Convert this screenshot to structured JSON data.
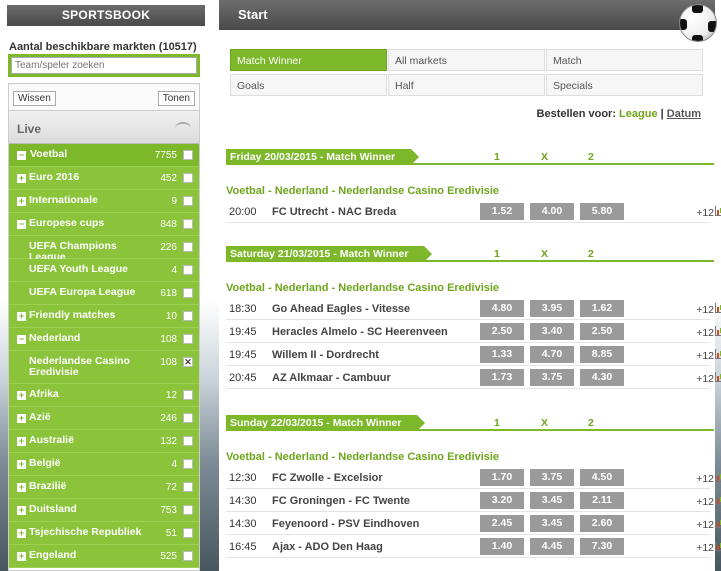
{
  "sidebar": {
    "title": "SPORTSBOOK",
    "markets_label": "Aantal beschikbare markten (10517)",
    "search_placeholder": "Team/speler zoeken",
    "clear_label": "Wissen",
    "show_label": "Tonen",
    "live_label": "Live",
    "categories": [
      {
        "name": "Voetbal",
        "count": "7755",
        "type": "main",
        "sign": "−"
      },
      {
        "name": "Euro 2016",
        "count": "452",
        "type": "sub",
        "sign": "+"
      },
      {
        "name": "Internationale",
        "count": "9",
        "type": "sub",
        "sign": "+"
      },
      {
        "name": "Europese cups",
        "count": "848",
        "type": "sub",
        "sign": "−"
      },
      {
        "name": "UEFA Champions League",
        "count": "226",
        "type": "subsub"
      },
      {
        "name": "UEFA Youth League",
        "count": "4",
        "type": "subsub"
      },
      {
        "name": "UEFA Europa League",
        "count": "618",
        "type": "subsub"
      },
      {
        "name": "Friendly matches",
        "count": "10",
        "type": "sub",
        "sign": "+"
      },
      {
        "name": "Nederland",
        "count": "108",
        "type": "sub",
        "sign": "−"
      },
      {
        "name": "Nederlandse Casino Eredivisie",
        "count": "108",
        "type": "subsub",
        "checked": true
      },
      {
        "name": "Afrika",
        "count": "12",
        "type": "sub",
        "sign": "+"
      },
      {
        "name": "Azië",
        "count": "246",
        "type": "sub",
        "sign": "+"
      },
      {
        "name": "Australië",
        "count": "132",
        "type": "sub",
        "sign": "+"
      },
      {
        "name": "België",
        "count": "4",
        "type": "sub",
        "sign": "+"
      },
      {
        "name": "Brazilië",
        "count": "72",
        "type": "sub",
        "sign": "+"
      },
      {
        "name": "Duitsland",
        "count": "753",
        "type": "sub",
        "sign": "+"
      },
      {
        "name": "Tsjechische Republiek",
        "count": "51",
        "type": "sub",
        "sign": "+"
      },
      {
        "name": "Engeland",
        "count": "525",
        "type": "sub",
        "sign": "+"
      }
    ]
  },
  "main": {
    "title": "Start",
    "tabs": [
      {
        "label": "Match Winner",
        "active": true
      },
      {
        "label": "All markets"
      },
      {
        "label": "Match"
      },
      {
        "label": "Goals"
      },
      {
        "label": "Half"
      },
      {
        "label": "Specials"
      }
    ],
    "sort_label": "Bestellen voor:",
    "sort_league": "League",
    "sort_sep": "|",
    "sort_date": "Datum",
    "col1": "1",
    "colx": "X",
    "col2": "2",
    "days": [
      {
        "heading": "Friday 20/03/2015 - Match Winner",
        "league": "Voetbal - Nederland - Nederlandse Casino Eredivisie",
        "matches": [
          {
            "time": "20:00",
            "teams": "FC Utrecht - NAC Breda",
            "o1": "1.52",
            "ox": "4.00",
            "o2": "5.80",
            "more": "+12"
          }
        ]
      },
      {
        "heading": "Saturday 21/03/2015 - Match Winner",
        "league": "Voetbal - Nederland - Nederlandse Casino Eredivisie",
        "matches": [
          {
            "time": "18:30",
            "teams": "Go Ahead Eagles - Vitesse",
            "o1": "4.80",
            "ox": "3.95",
            "o2": "1.62",
            "more": "+12"
          },
          {
            "time": "19:45",
            "teams": "Heracles Almelo - SC Heerenveen",
            "o1": "2.50",
            "ox": "3.40",
            "o2": "2.50",
            "more": "+12"
          },
          {
            "time": "19:45",
            "teams": "Willem II - Dordrecht",
            "o1": "1.33",
            "ox": "4.70",
            "o2": "8.85",
            "more": "+12"
          },
          {
            "time": "20:45",
            "teams": "AZ Alkmaar - Cambuur",
            "o1": "1.73",
            "ox": "3.75",
            "o2": "4.30",
            "more": "+12"
          }
        ]
      },
      {
        "heading": "Sunday 22/03/2015 - Match Winner",
        "league": "Voetbal - Nederland - Nederlandse Casino Eredivisie",
        "matches": [
          {
            "time": "12:30",
            "teams": "FC Zwolle - Excelsior",
            "o1": "1.70",
            "ox": "3.75",
            "o2": "4.50",
            "more": "+12"
          },
          {
            "time": "14:30",
            "teams": "FC Groningen - FC Twente",
            "o1": "3.20",
            "ox": "3.45",
            "o2": "2.11",
            "more": "+12"
          },
          {
            "time": "14:30",
            "teams": "Feyenoord - PSV Eindhoven",
            "o1": "2.45",
            "ox": "3.45",
            "o2": "2.60",
            "more": "+12"
          },
          {
            "time": "16:45",
            "teams": "Ajax - ADO Den Haag",
            "o1": "1.40",
            "ox": "4.45",
            "o2": "7.30",
            "more": "+12"
          }
        ]
      }
    ]
  }
}
